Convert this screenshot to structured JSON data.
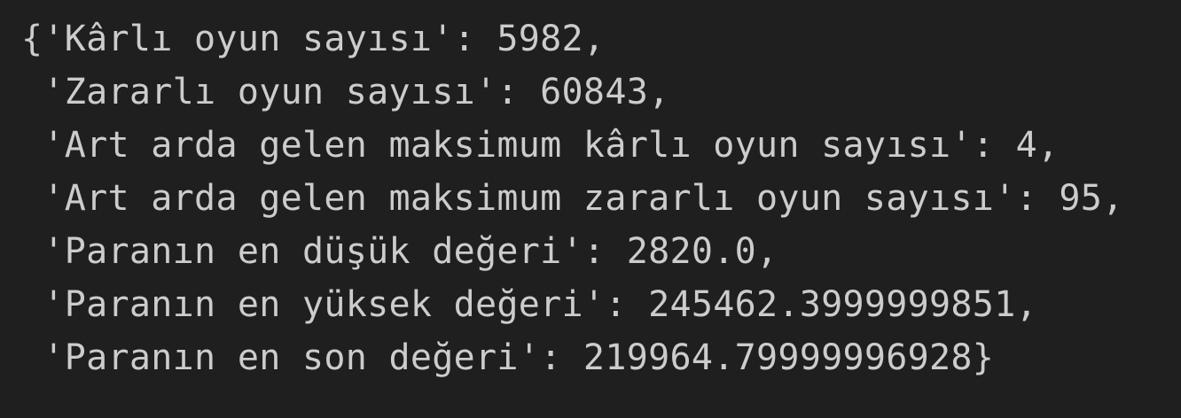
{
  "output": {
    "lines": [
      "{'Kârlı oyun sayısı': 5982,",
      " 'Zararlı oyun sayısı': 60843,",
      " 'Art arda gelen maksimum kârlı oyun sayısı': 4,",
      " 'Art arda gelen maksimum zararlı oyun sayısı': 95,",
      " 'Paranın en düşük değeri': 2820.0,",
      " 'Paranın en yüksek değeri': 245462.3999999851,",
      " 'Paranın en son değeri': 219964.79999996928}"
    ]
  }
}
